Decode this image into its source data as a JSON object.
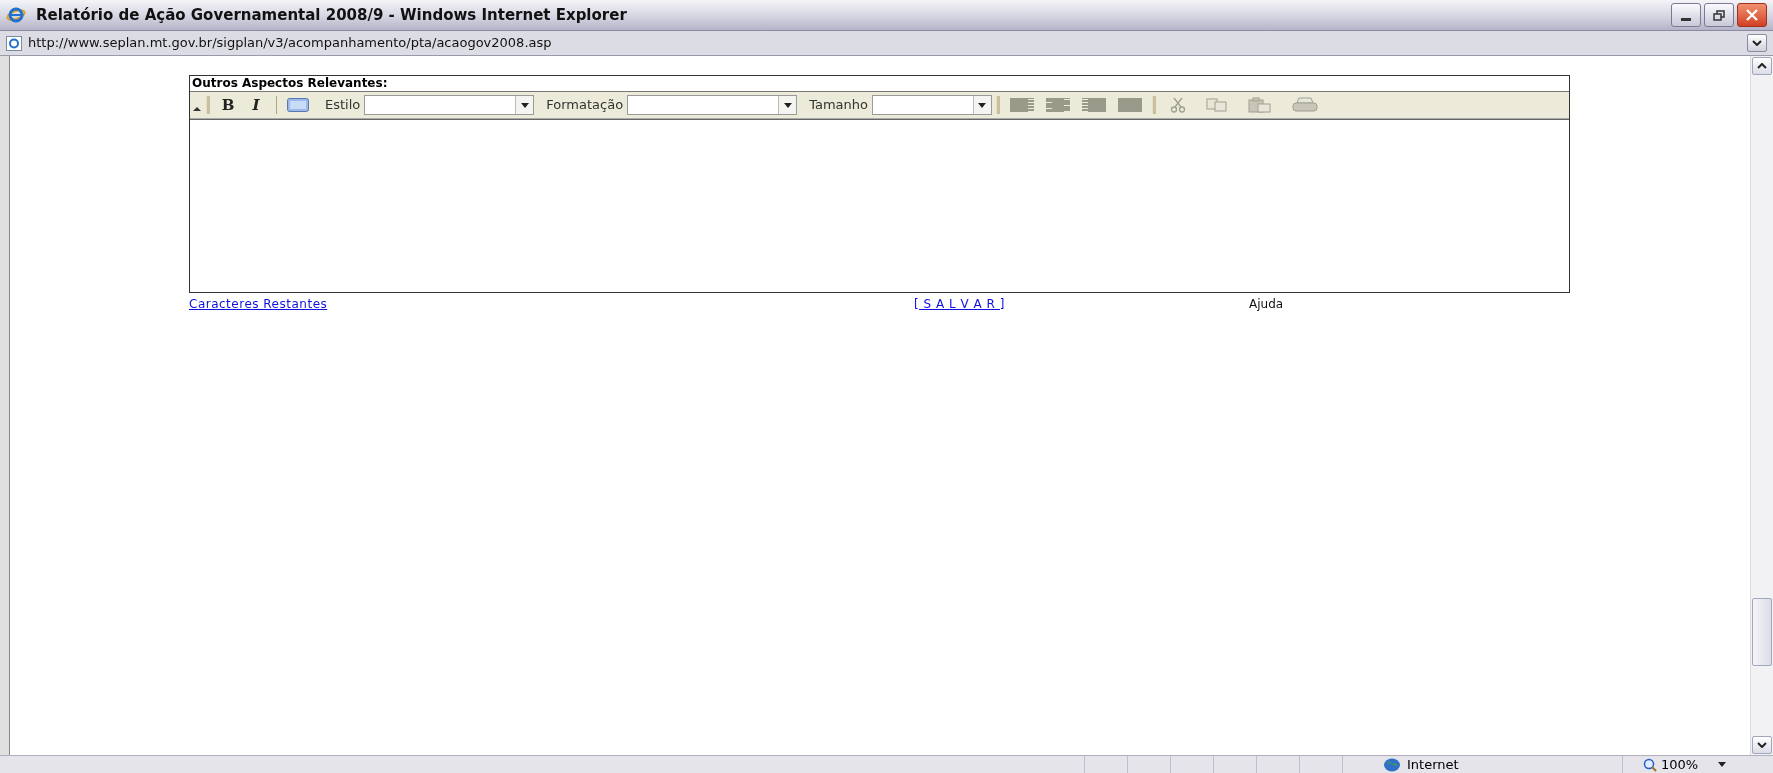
{
  "window": {
    "title": "Relatório de Ação Governamental 2008/9 - Windows Internet Explorer"
  },
  "address_bar": {
    "url": "http://www.seplan.mt.gov.br/sigplan/v3/acompanhamento/pta/acaogov2008.asp"
  },
  "editor": {
    "title": "Outros Aspectos Relevantes:",
    "format_buttons": [
      {
        "label": "B",
        "kind": "bold"
      },
      {
        "label": "I",
        "kind": "italic"
      }
    ],
    "dropdowns": [
      {
        "label": "Estilo"
      },
      {
        "label": "Formatação"
      },
      {
        "label": "Tamanho"
      }
    ]
  },
  "links": [
    {
      "text": "Caracteres Restantes",
      "kind": "link"
    },
    {
      "text": "[ S A L V A R ]",
      "kind": "link"
    },
    {
      "text": "Ajuda",
      "kind": "plain"
    }
  ],
  "status_bar": {
    "zone": "Internet",
    "zoom": "100%"
  }
}
